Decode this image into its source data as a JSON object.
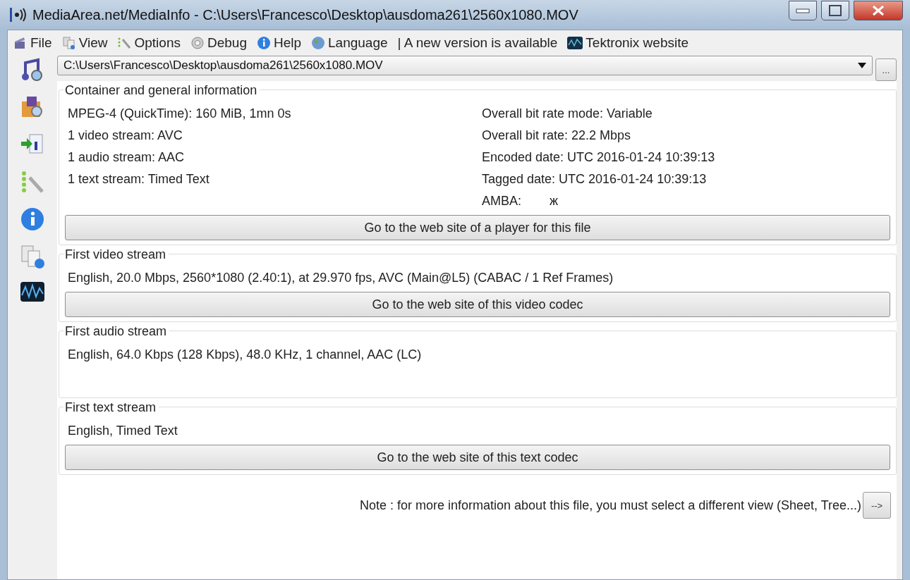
{
  "window": {
    "title": "MediaArea.net/MediaInfo - C:\\Users\\Francesco\\Desktop\\ausdoma261\\2560x1080.MOV"
  },
  "menu": [
    {
      "label": "File",
      "kind": "file"
    },
    {
      "label": "View",
      "kind": "view"
    },
    {
      "label": "Options",
      "kind": "options"
    },
    {
      "label": "Debug",
      "kind": "debug"
    },
    {
      "label": "Help",
      "kind": "help"
    },
    {
      "label": "Language",
      "kind": "language"
    }
  ],
  "notice": "| A new version is available",
  "website_link": "Tektronix website",
  "file_combo": {
    "value": "C:\\Users\\Francesco\\Desktop\\ausdoma261\\2560x1080.MOV",
    "browse_button": "..."
  },
  "sections": [
    {
      "title": "Container and general information",
      "left": [
        "MPEG-4 (QuickTime): 160 MiB, 1mn 0s",
        "1 video stream: AVC",
        "1 audio stream: AAC",
        "1 text stream: Timed Text"
      ],
      "right": [
        "Overall bit rate mode: Variable",
        "Overall bit rate: 22.2 Mbps",
        "Encoded date: UTC 2016-01-24 10:39:13",
        "Tagged date: UTC 2016-01-24 10:39:13",
        "AMBA:        ж"
      ],
      "button": "Go to the web site of a player for this file"
    },
    {
      "title": "First video stream",
      "left": [
        "English, 20.0 Mbps, 2560*1080 (2.40:1), at 29.970 fps, AVC (Main@L5) (CABAC / 1 Ref Frames)"
      ],
      "button": "Go to the web site of this video codec"
    },
    {
      "title": "First audio stream",
      "left": [
        "English, 64.0 Kbps (128 Kbps), 48.0 KHz, 1 channel, AAC (LC)"
      ]
    },
    {
      "title": "First text stream",
      "left": [
        "English, Timed Text"
      ],
      "button": "Go to the web site of this text codec"
    }
  ],
  "note": {
    "text": "Note : for more information about this file, you must select a different view (Sheet, Tree...)",
    "button": "-->"
  }
}
